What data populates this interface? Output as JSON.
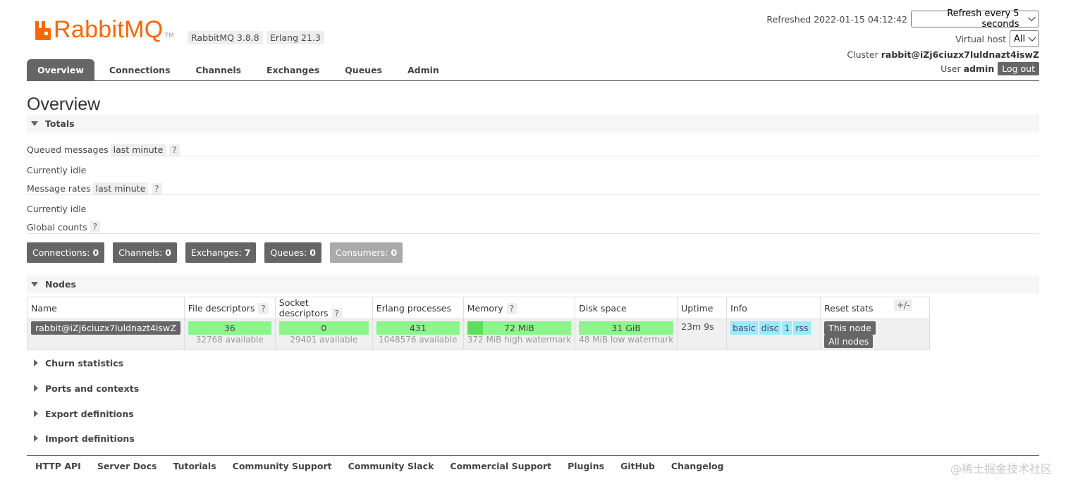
{
  "brand": {
    "logo_text": "RabbitMQ",
    "tm": "TM",
    "accent": "#ff6600"
  },
  "versions": {
    "rabbitmq": "RabbitMQ 3.8.8",
    "erlang": "Erlang 21.3"
  },
  "header": {
    "refreshed_label": "Refreshed",
    "refreshed_time": "2022-01-15 04:12:42",
    "refresh_select": "Refresh every 5 seconds",
    "vhost_label": "Virtual host",
    "vhost_select": "All",
    "cluster_label": "Cluster",
    "cluster_name": "rabbit@iZj6ciuzx7luldnazt4iswZ",
    "user_label": "User",
    "user_name": "admin",
    "logout": "Log out"
  },
  "tabs": [
    "Overview",
    "Connections",
    "Channels",
    "Exchanges",
    "Queues",
    "Admin"
  ],
  "page_title": "Overview",
  "totals": {
    "header": "Totals",
    "queued_label": "Queued messages",
    "queued_range": "last minute",
    "help": "?",
    "idle1": "Currently idle",
    "rates_label": "Message rates",
    "rates_range": "last minute",
    "idle2": "Currently idle",
    "global_label": "Global counts"
  },
  "counts": [
    {
      "label": "Connections:",
      "value": "0"
    },
    {
      "label": "Channels:",
      "value": "0"
    },
    {
      "label": "Exchanges:",
      "value": "7"
    },
    {
      "label": "Queues:",
      "value": "0"
    },
    {
      "label": "Consumers:",
      "value": "0"
    }
  ],
  "nodes": {
    "header": "Nodes",
    "columns": [
      "Name",
      "File descriptors",
      "Socket descriptors",
      "Erlang processes",
      "Memory",
      "Disk space",
      "Uptime",
      "Info",
      "Reset stats"
    ],
    "plusminus": "+/-",
    "row": {
      "name": "rabbit@iZj6ciuzx7luldnazt4iswZ",
      "fd": "36",
      "fd_sub": "32768 available",
      "sd": "0",
      "sd_sub": "29401 available",
      "ep": "431",
      "ep_sub": "1048576 available",
      "mem": "72 MiB",
      "mem_sub": "372 MiB high watermark",
      "disk": "31 GiB",
      "disk_sub": "48 MiB low watermark",
      "uptime": "23m 9s",
      "info_tags": [
        "basic",
        "disc",
        "1",
        "rss"
      ],
      "reset_this": "This node",
      "reset_all": "All nodes"
    }
  },
  "collapsed_sections": [
    "Churn statistics",
    "Ports and contexts",
    "Export definitions",
    "Import definitions"
  ],
  "footer": [
    "HTTP API",
    "Server Docs",
    "Tutorials",
    "Community Support",
    "Community Slack",
    "Commercial Support",
    "Plugins",
    "GitHub",
    "Changelog"
  ],
  "watermark": "@稀土掘金技术社区"
}
